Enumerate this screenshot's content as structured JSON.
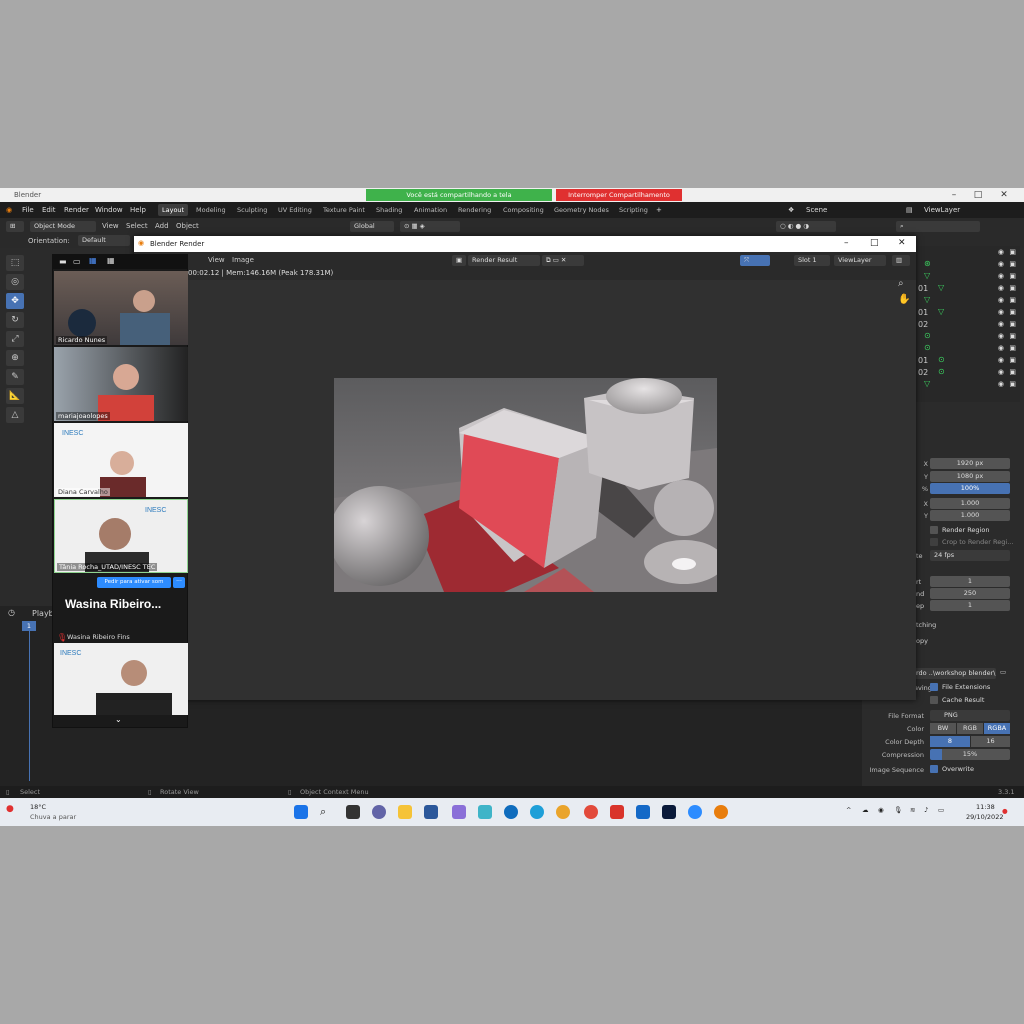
{
  "window": {
    "title": "Blender",
    "share_banner": "Você está compartilhando a tela",
    "stop_share": "Interromper Compartilhamento"
  },
  "menu": {
    "items": [
      "File",
      "Edit",
      "Render",
      "Window",
      "Help"
    ]
  },
  "workspaces": [
    "Layout",
    "Modeling",
    "Sculpting",
    "UV Editing",
    "Texture Paint",
    "Shading",
    "Animation",
    "Rendering",
    "Compositing",
    "Geometry Nodes",
    "Scripting"
  ],
  "scene": {
    "scene_label": "Scene",
    "view_layer": "ViewLayer"
  },
  "header2": {
    "mode": "Object Mode",
    "view": "View",
    "select": "Select",
    "add": "Add",
    "object": "Object",
    "transform": "Global"
  },
  "header3": {
    "orientation_label": "Orientation:",
    "orientation_value": "Default"
  },
  "render_window": {
    "title": "Blender Render",
    "menu_view": "View",
    "menu_image": "Image",
    "image_name": "Render Result",
    "slot": "Slot 1",
    "layer": "ViewLayer",
    "stats": "00:02.12 | Mem:146.16M (Peak 178.31M)"
  },
  "outliner": {
    "rows": [
      "",
      "01",
      "",
      "01",
      "02",
      "",
      "",
      "01",
      "02",
      "",
      ""
    ]
  },
  "properties": {
    "res_x": "1920 px",
    "res_y": "1080 px",
    "res_pct": "100%",
    "aspect_x": "1.000",
    "aspect_y": "1.000",
    "render_region": "Render Region",
    "crop": "Crop to Render Regi...",
    "frame_rate_label": "te",
    "frame_rate": "24 fps",
    "frame_start_label": "rt",
    "frame_start": "1",
    "frame_end_label": "nd",
    "frame_end": "250",
    "frame_step_label": "ep",
    "frame_step": "1",
    "stretching": "tching",
    "copy": "opy",
    "output_path": "rdo ..\\workshop blender\\",
    "saving": "aving",
    "file_ext": "File Extensions",
    "cache": "Cache Result",
    "file_format_label": "File Format",
    "file_format": "PNG",
    "color_label": "Color",
    "color_opts": [
      "BW",
      "RGB",
      "RGBA"
    ],
    "depth_label": "Color Depth",
    "depth_opts": [
      "8",
      "16"
    ],
    "compression_label": "Compression",
    "compression": "15%",
    "seq_label": "Image Sequence",
    "overwrite": "Overwrite"
  },
  "timeline": {
    "playback": "Playba",
    "frame": "1"
  },
  "zoom": {
    "participants": [
      {
        "name": "Ricardo Nunes"
      },
      {
        "name": "mariajoaolopes"
      },
      {
        "name": "Diana Carvalho"
      },
      {
        "name": "Tânia Rocha_UTAD/INESC TEC"
      }
    ],
    "ask_unmute": "Pedir para ativar som",
    "big_name": "Wasina  Ribeiro...",
    "sub_name": "Wasina Ribeiro Fins"
  },
  "status": {
    "select": "Select",
    "rotate": "Rotate View",
    "context": "Object Context Menu",
    "version": "3.3.1"
  },
  "taskbar": {
    "temp": "18°C",
    "weather": "Chuva a parar",
    "time": "11:38",
    "date": "29/10/2022"
  }
}
